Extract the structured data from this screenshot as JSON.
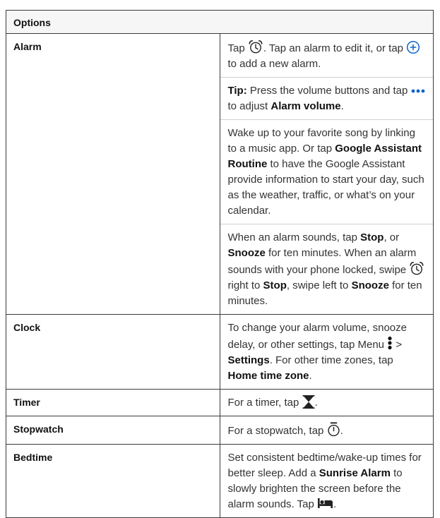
{
  "table": {
    "header": "Options",
    "alarm": {
      "label": "Alarm",
      "p1_a": "Tap ",
      "p1_b": ". Tap an alarm to edit it, or tap ",
      "p1_c": " to add a new alarm.",
      "p2_tip": "Tip:",
      "p2_a": " Press the volume buttons and tap ",
      "p2_b": " to adjust ",
      "p2_bold": "Alarm volume",
      "p2_c": ".",
      "p3_a": "Wake up to your favorite song by linking to a music app. Or tap ",
      "p3_bold": "Google Assistant Routine",
      "p3_b": " to have the Google Assistant provide information to start your day, such as the weather, traffic, or what’s on your calendar.",
      "p4_a": "When an alarm sounds, tap ",
      "p4_stop": "Stop",
      "p4_b": ", or ",
      "p4_snooze": "Snooze",
      "p4_c": " for ten minutes. When an alarm sounds with your phone locked, swipe ",
      "p4_d": " right to ",
      "p4_stop2": "Stop",
      "p4_e": ", swipe left to ",
      "p4_snooze2": "Snooze",
      "p4_f": " for ten minutes."
    },
    "clock": {
      "label": "Clock",
      "a": "To change your alarm volume, snooze delay, or other settings, tap Menu ",
      "b": " > ",
      "bold1": "Settings",
      "c": ". For other time zones, tap ",
      "bold2": "Home time zone",
      "d": "."
    },
    "timer": {
      "label": "Timer",
      "a": "For a timer, tap ",
      "b": "."
    },
    "stopwatch": {
      "label": "Stopwatch",
      "a": "For a stopwatch, tap ",
      "b": "."
    },
    "bedtime": {
      "label": "Bedtime",
      "a": "Set consistent bedtime/wake-up times for better sleep. Add a ",
      "bold": "Sunrise Alarm",
      "b": " to slowly brighten the screen before the alarm sounds. Tap ",
      "c": "."
    }
  },
  "icons": {
    "alarm": "alarm-clock-icon",
    "add": "add-circle-icon",
    "more": "more-dots-icon",
    "menu": "menu-vertical-icon",
    "timer": "hourglass-icon",
    "stopwatch": "stopwatch-icon",
    "bedtime": "bed-icon"
  },
  "colors": {
    "accent": "#0a63c9",
    "border": "#3a3a3a",
    "header_bg": "#f6f6f6",
    "text": "#333333"
  }
}
